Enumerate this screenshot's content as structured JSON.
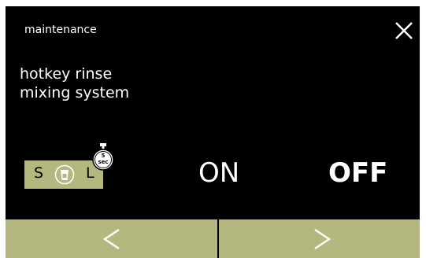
{
  "header": {
    "title": "maintenance"
  },
  "page": {
    "heading_line1": "hotkey rinse",
    "heading_line2": "mixing system"
  },
  "size_selector": {
    "small_label": "S",
    "large_label": "L",
    "icon": "cup-icon"
  },
  "timer": {
    "value": "5",
    "unit": "sec",
    "icon": "stopwatch-icon"
  },
  "toggle": {
    "on_label": "ON",
    "off_label": "OFF",
    "selected": "OFF"
  },
  "navigation": {
    "prev_icon": "chevron-left-icon",
    "next_icon": "chevron-right-icon"
  },
  "colors": {
    "background": "#000000",
    "accent": "#b5b87e",
    "text": "#ffffff"
  }
}
